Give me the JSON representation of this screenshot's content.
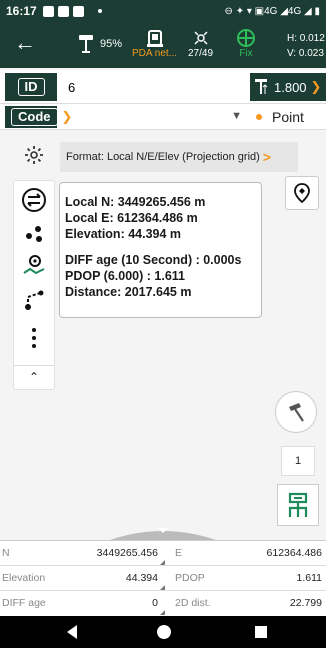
{
  "status_bar": {
    "time": "16:17",
    "indicators": "⊖ ✦ ▾ ▣4G ◢4G ◢ ▮"
  },
  "header": {
    "back_icon": "back-arrow-icon",
    "battery": "95%",
    "pda_label": "PDA net...",
    "satellites": "27/49",
    "fix_label": "Fix",
    "h_precision": "H: 0.012",
    "v_precision": "V: 0.023"
  },
  "point_id": {
    "label": "ID",
    "value": "6"
  },
  "antenna": {
    "height": "1.800"
  },
  "code": {
    "label": "Code",
    "value": ""
  },
  "point_type": "Point",
  "format": {
    "label": "Format: Local N/E/Elev (Projection grid)"
  },
  "info_card": {
    "local_n": "Local N: 3449265.456 m",
    "local_e": "Local E: 612364.486 m",
    "elevation": "Elevation: 44.394 m",
    "diff_age_label": "DIFF age (10 Second) : ",
    "diff_age_value": "0.000s",
    "pdop_label": "PDOP (6.000) : ",
    "pdop_value": "1.611",
    "distance": "Distance: 2017.645 m"
  },
  "counter": "1",
  "grid": [
    {
      "label1": "N",
      "value1": "3449265.456",
      "label2": "E",
      "value2": "612364.486"
    },
    {
      "label1": "Elevation",
      "value1": "44.394",
      "label2": "PDOP",
      "value2": "1.611"
    },
    {
      "label1": "DIFF age",
      "value1": "0",
      "label2": "2D dist.",
      "value2": "22.799"
    }
  ],
  "colors": {
    "header_bg": "#1b3d34",
    "accent_orange": "#f39a1e",
    "fix_green": "#2fbe5a",
    "tool_green": "#1e8a5c"
  }
}
